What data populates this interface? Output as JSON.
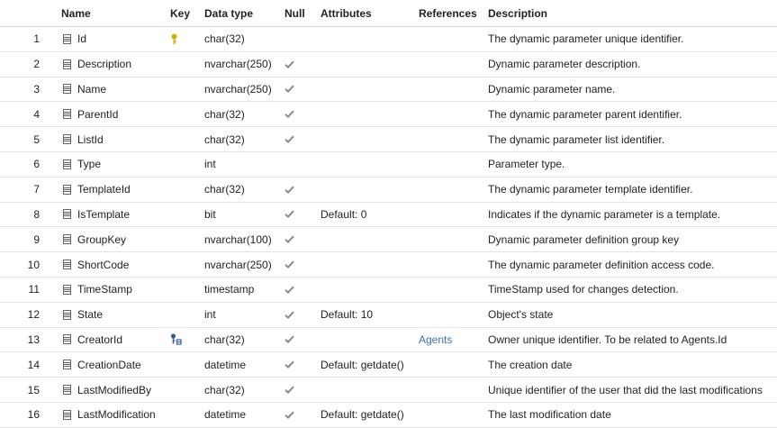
{
  "headers": {
    "name": "Name",
    "key": "Key",
    "type": "Data type",
    "null": "Null",
    "attr": "Attributes",
    "ref": "References",
    "desc": "Description"
  },
  "rows": [
    {
      "n": "1",
      "name": "Id",
      "key": "primary",
      "type": "char(32)",
      "nullable": false,
      "attr": "",
      "ref": "",
      "desc": "The dynamic parameter unique identifier."
    },
    {
      "n": "2",
      "name": "Description",
      "key": "",
      "type": "nvarchar(250)",
      "nullable": true,
      "attr": "",
      "ref": "",
      "desc": "Dynamic parameter description."
    },
    {
      "n": "3",
      "name": "Name",
      "key": "",
      "type": "nvarchar(250)",
      "nullable": true,
      "attr": "",
      "ref": "",
      "desc": "Dynamic parameter name."
    },
    {
      "n": "4",
      "name": "ParentId",
      "key": "",
      "type": "char(32)",
      "nullable": true,
      "attr": "",
      "ref": "",
      "desc": "The dynamic parameter parent identifier."
    },
    {
      "n": "5",
      "name": "ListId",
      "key": "",
      "type": "char(32)",
      "nullable": true,
      "attr": "",
      "ref": "",
      "desc": "The dynamic parameter list identifier."
    },
    {
      "n": "6",
      "name": "Type",
      "key": "",
      "type": "int",
      "nullable": false,
      "attr": "",
      "ref": "",
      "desc": "Parameter type."
    },
    {
      "n": "7",
      "name": "TemplateId",
      "key": "",
      "type": "char(32)",
      "nullable": true,
      "attr": "",
      "ref": "",
      "desc": "The dynamic parameter template identifier."
    },
    {
      "n": "8",
      "name": "IsTemplate",
      "key": "",
      "type": "bit",
      "nullable": true,
      "attr": "Default: 0",
      "ref": "",
      "desc": "Indicates if the dynamic parameter is a template."
    },
    {
      "n": "9",
      "name": "GroupKey",
      "key": "",
      "type": "nvarchar(100)",
      "nullable": true,
      "attr": "",
      "ref": "",
      "desc": "Dynamic parameter definition group key"
    },
    {
      "n": "10",
      "name": "ShortCode",
      "key": "",
      "type": "nvarchar(250)",
      "nullable": true,
      "attr": "",
      "ref": "",
      "desc": "The dynamic parameter definition access code."
    },
    {
      "n": "11",
      "name": "TimeStamp",
      "key": "",
      "type": "timestamp",
      "nullable": true,
      "attr": "",
      "ref": "",
      "desc": "TimeStamp used for changes detection."
    },
    {
      "n": "12",
      "name": "State",
      "key": "",
      "type": "int",
      "nullable": true,
      "attr": "Default: 10",
      "ref": "",
      "desc": "Object's state"
    },
    {
      "n": "13",
      "name": "CreatorId",
      "key": "foreign",
      "type": "char(32)",
      "nullable": true,
      "attr": "",
      "ref": "Agents",
      "desc": "Owner unique identifier. To be related to Agents.Id"
    },
    {
      "n": "14",
      "name": "CreationDate",
      "key": "",
      "type": "datetime",
      "nullable": true,
      "attr": "Default: getdate()",
      "ref": "",
      "desc": "The creation date"
    },
    {
      "n": "15",
      "name": "LastModifiedBy",
      "key": "",
      "type": "char(32)",
      "nullable": true,
      "attr": "",
      "ref": "",
      "desc": "Unique identifier of the user that did the last modifications"
    },
    {
      "n": "16",
      "name": "LastModification",
      "key": "",
      "type": "datetime",
      "nullable": true,
      "attr": "Default: getdate()",
      "ref": "",
      "desc": "The last modification date"
    }
  ],
  "colors": {
    "primary_key": "#c9b200",
    "foreign_key": "#2f5f9e",
    "check": "#8a8a8a",
    "link": "#3c6fb6"
  }
}
